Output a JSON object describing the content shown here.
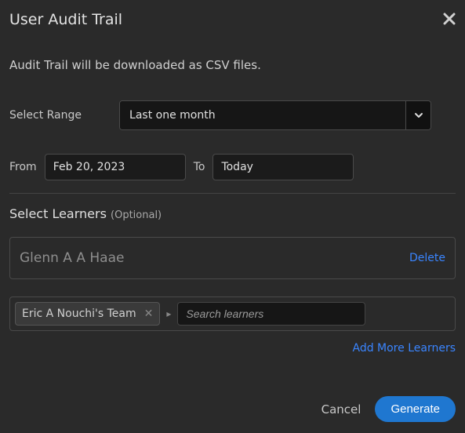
{
  "header": {
    "title": "User Audit Trail"
  },
  "info": "Audit Trail will be downloaded as CSV files.",
  "range": {
    "label": "Select Range",
    "value": "Last one month"
  },
  "dates": {
    "from_label": "From",
    "from_value": "Feb 20, 2023",
    "to_label": "To",
    "to_value": "Today"
  },
  "learners": {
    "title": "Select Learners",
    "optional": "(Optional)",
    "items": [
      {
        "name": "Glenn A A Haae",
        "delete_label": "Delete"
      }
    ],
    "tag": {
      "label": "Eric A Nouchi's Team"
    },
    "search_placeholder": "Search learners",
    "add_more": "Add More Learners"
  },
  "footer": {
    "cancel": "Cancel",
    "generate": "Generate"
  }
}
